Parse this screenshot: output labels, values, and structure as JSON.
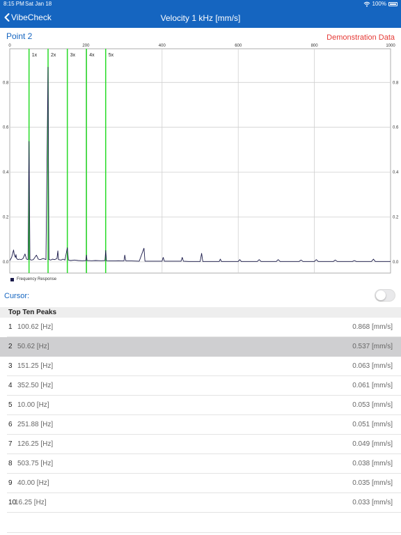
{
  "status_bar": {
    "time": "8:15 PM",
    "date": "Sat Jan 18",
    "battery": "100%"
  },
  "nav": {
    "back_label": "VibeCheck",
    "title": "Velocity 1 kHz [mm/s]"
  },
  "point_label": "Point 2",
  "demo_label": "Demonstration Data",
  "colors": {
    "nav": "#1565c0",
    "harmonic_marker": "#33dd33",
    "series": "#1a1a4a",
    "demo_label": "#e53935"
  },
  "chart_data": {
    "type": "line",
    "title": "",
    "xlabel": "",
    "ylabel": "",
    "xlim": [
      0,
      1000
    ],
    "ylim": [
      -0.05,
      0.95
    ],
    "x_ticks": [
      "0",
      "200",
      "400",
      "600",
      "800",
      "1000"
    ],
    "y_ticks": [
      "0.0",
      "0.2",
      "0.4",
      "0.6",
      "0.8"
    ],
    "grid": true,
    "legend": "bottom-left",
    "series": [
      {
        "name": "Frequency Response",
        "x": [
          0,
          5,
          8,
          10,
          12,
          15,
          16.25,
          18,
          22,
          25,
          30,
          35,
          40,
          44,
          48,
          50.62,
          53,
          57,
          62,
          70,
          75,
          80,
          88,
          95,
          100.62,
          103,
          108,
          112,
          118,
          124,
          126.25,
          128,
          135,
          140,
          145,
          151.25,
          154,
          160,
          170,
          180,
          190,
          200,
          201.5,
          203,
          215,
          225,
          240,
          250,
          251.88,
          254,
          270,
          285,
          300,
          302,
          305,
          320,
          340,
          352.5,
          355,
          370,
          390,
          400,
          403,
          406,
          420,
          440,
          450,
          453,
          456,
          470,
          490,
          500,
          503.75,
          507,
          520,
          540,
          550,
          553,
          556,
          570,
          600,
          604,
          608,
          630,
          650,
          655,
          660,
          690,
          700,
          705,
          710,
          740,
          760,
          765,
          770,
          790,
          800,
          805,
          810,
          840,
          850,
          855,
          860,
          880,
          900,
          905,
          910,
          940,
          950,
          955,
          960,
          990,
          1000
        ],
        "y": [
          0.005,
          0.02,
          0.04,
          0.053,
          0.03,
          0.02,
          0.033,
          0.015,
          0.01,
          0.012,
          0.01,
          0.015,
          0.035,
          0.012,
          0.01,
          0.537,
          0.01,
          0.008,
          0.01,
          0.03,
          0.012,
          0.01,
          0.015,
          0.01,
          0.868,
          0.01,
          0.008,
          0.012,
          0.01,
          0.015,
          0.049,
          0.01,
          0.008,
          0.012,
          0.008,
          0.063,
          0.008,
          0.006,
          0.008,
          0.006,
          0.005,
          0.006,
          0.03,
          0.006,
          0.005,
          0.006,
          0.005,
          0.006,
          0.051,
          0.005,
          0.004,
          0.005,
          0.004,
          0.03,
          0.004,
          0.004,
          0.003,
          0.061,
          0.003,
          0.003,
          0.003,
          0.003,
          0.02,
          0.003,
          0.003,
          0.003,
          0.003,
          0.02,
          0.003,
          0.002,
          0.002,
          0.002,
          0.038,
          0.002,
          0.002,
          0.002,
          0.002,
          0.012,
          0.002,
          0.002,
          0.002,
          0.01,
          0.002,
          0.002,
          0.002,
          0.01,
          0.002,
          0.002,
          0.002,
          0.01,
          0.002,
          0.002,
          0.002,
          0.008,
          0.002,
          0.002,
          0.002,
          0.01,
          0.002,
          0.002,
          0.002,
          0.008,
          0.002,
          0.002,
          0.002,
          0.006,
          0.002,
          0.002,
          0.002,
          0.012,
          0.002,
          0.002,
          0.002
        ]
      }
    ],
    "harmonics": [
      {
        "label": "1x",
        "x": 50.62
      },
      {
        "label": "2x",
        "x": 100.62
      },
      {
        "label": "3x",
        "x": 151.25
      },
      {
        "label": "4x",
        "x": 201.5
      },
      {
        "label": "5x",
        "x": 251.88
      }
    ]
  },
  "cursor": {
    "label": "Cursor:",
    "enabled": false
  },
  "peaks": {
    "header": "Top Ten Peaks",
    "selected_index": 1,
    "rows": [
      {
        "rank": "1",
        "freq": "100.62 [Hz]",
        "amp": "0.868 [mm/s]"
      },
      {
        "rank": "2",
        "freq": "50.62 [Hz]",
        "amp": "0.537 [mm/s]"
      },
      {
        "rank": "3",
        "freq": "151.25 [Hz]",
        "amp": "0.063 [mm/s]"
      },
      {
        "rank": "4",
        "freq": "352.50 [Hz]",
        "amp": "0.061 [mm/s]"
      },
      {
        "rank": "5",
        "freq": "10.00 [Hz]",
        "amp": "0.053 [mm/s]"
      },
      {
        "rank": "6",
        "freq": "251.88 [Hz]",
        "amp": "0.051 [mm/s]"
      },
      {
        "rank": "7",
        "freq": "126.25 [Hz]",
        "amp": "0.049 [mm/s]"
      },
      {
        "rank": "8",
        "freq": "503.75 [Hz]",
        "amp": "0.038 [mm/s]"
      },
      {
        "rank": "9",
        "freq": "40.00 [Hz]",
        "amp": "0.035 [mm/s]"
      },
      {
        "rank": "10",
        "freq": "16.25 [Hz]",
        "amp": "0.033 [mm/s]"
      }
    ]
  }
}
